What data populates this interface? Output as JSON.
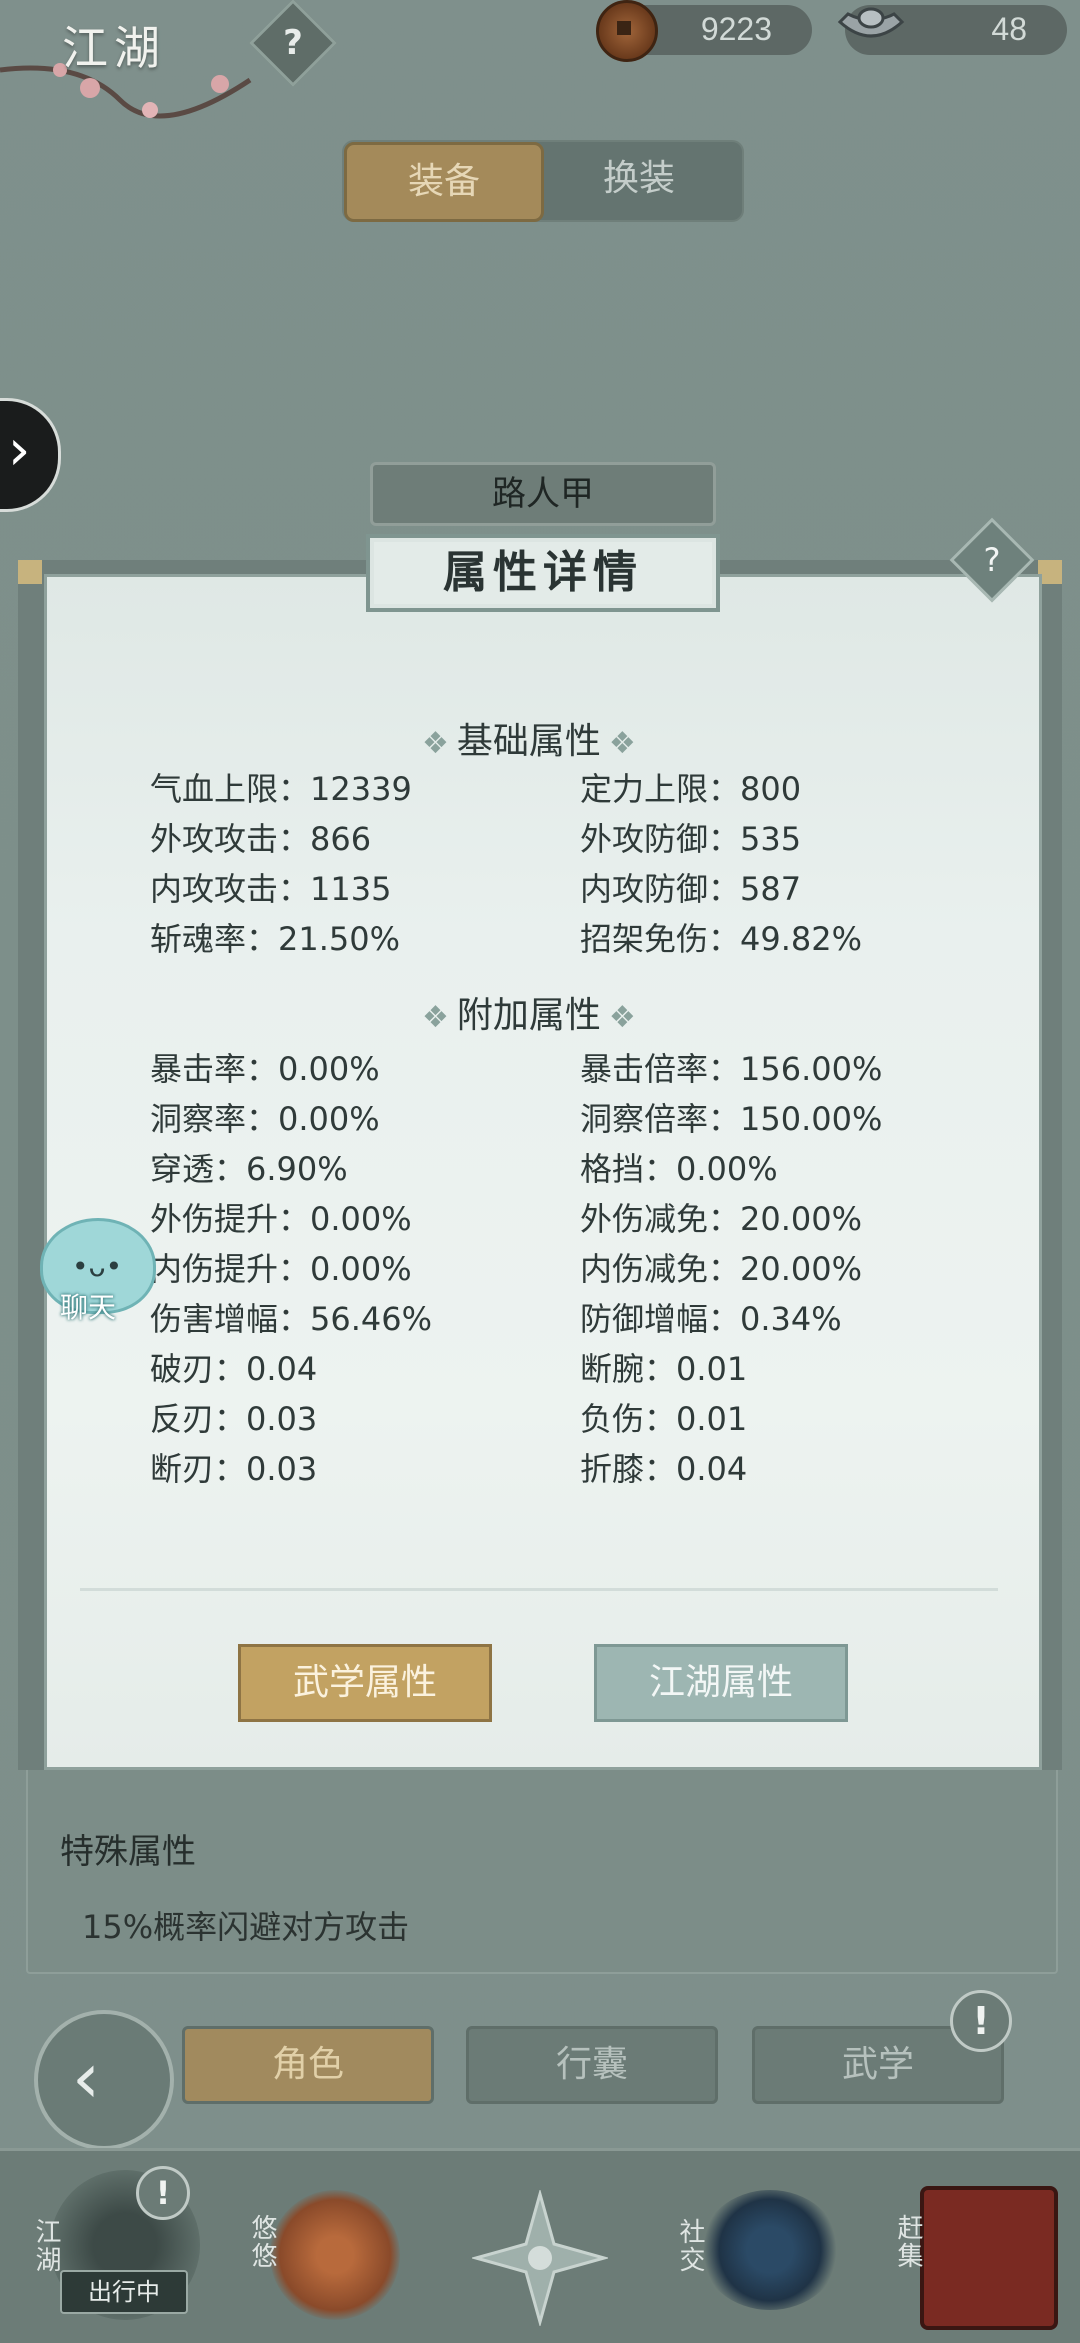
{
  "topbar": {
    "title": "江湖",
    "help_icon": "?",
    "copper": "9223",
    "silver": "48"
  },
  "tabs": {
    "equip": "装备",
    "change": "换装"
  },
  "character": {
    "name": "路人甲"
  },
  "panel": {
    "title": "属性详情",
    "help_icon": "?",
    "basic_title": "基础属性",
    "extra_title": "附加属性",
    "basic": [
      {
        "left": "气血上限：12339",
        "right": "定力上限：800"
      },
      {
        "left": "外攻攻击：866",
        "right": "外攻防御：535"
      },
      {
        "left": "内攻攻击：1135",
        "right": "内攻防御：587"
      },
      {
        "left": "斩魂率：21.50%",
        "right": "招架免伤：49.82%"
      }
    ],
    "extra": [
      {
        "left": "暴击率：0.00%",
        "right": "暴击倍率：156.00%"
      },
      {
        "left": "洞察率：0.00%",
        "right": "洞察倍率：150.00%"
      },
      {
        "left": "穿透：6.90%",
        "right": "格挡：0.00%"
      },
      {
        "left": "外伤提升：0.00%",
        "right": "外伤减免：20.00%"
      },
      {
        "left": "内伤提升：0.00%",
        "right": "内伤减免：20.00%"
      },
      {
        "left": "伤害增幅：56.46%",
        "right": "防御增幅：0.34%"
      },
      {
        "left": "破刃：0.04",
        "right": "断腕：0.01"
      },
      {
        "left": "反刃：0.03",
        "right": "负伤：0.01"
      },
      {
        "left": "断刃：0.03",
        "right": "折膝：0.04"
      }
    ],
    "btn_wuxue": "武学属性",
    "btn_jianghu": "江湖属性"
  },
  "chat": {
    "label": "聊天",
    "face": "•ᴗ•"
  },
  "under": {
    "special_title": "特殊属性",
    "special_desc": "15%概率闪避对方攻击"
  },
  "nav": {
    "back": "‹",
    "role": "角色",
    "bag": "行囊",
    "martial": "武学",
    "alert": "!"
  },
  "bottom": {
    "jianghu": "江湖",
    "youyou": "悠悠",
    "social": "社交",
    "market": "赶集",
    "travel": "出行中",
    "alert": "!"
  },
  "colors": {
    "accent_gold": "#c2a262",
    "accent_teal": "#9db6b2",
    "panel_bg": "#e9f0ee",
    "overlay": "#7f908c"
  }
}
